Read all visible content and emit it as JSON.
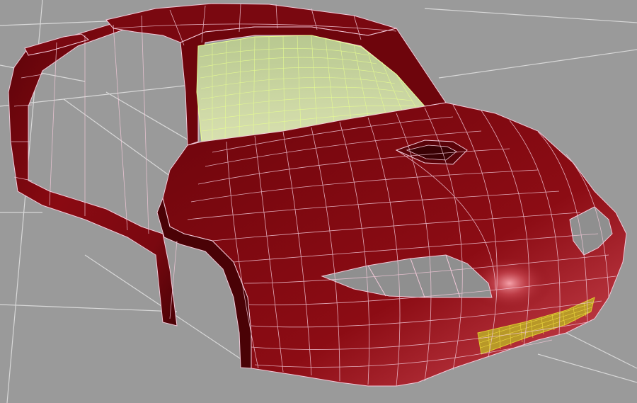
{
  "viewport": {
    "background_color": "#9a9a9a",
    "grid_color": "#d8d8d8",
    "grid_visible": true
  },
  "model": {
    "body_color": "#8a0a12",
    "body_shadow_color": "#4a0206",
    "body_highlight_color": "#c0404a",
    "wire_color": "#f2c8d8",
    "windshield_color": "#c8d8a0",
    "windshield_wire_color": "#e8ff90",
    "grille_color": "#e0c830",
    "opening_color": "#8f8f8f"
  }
}
